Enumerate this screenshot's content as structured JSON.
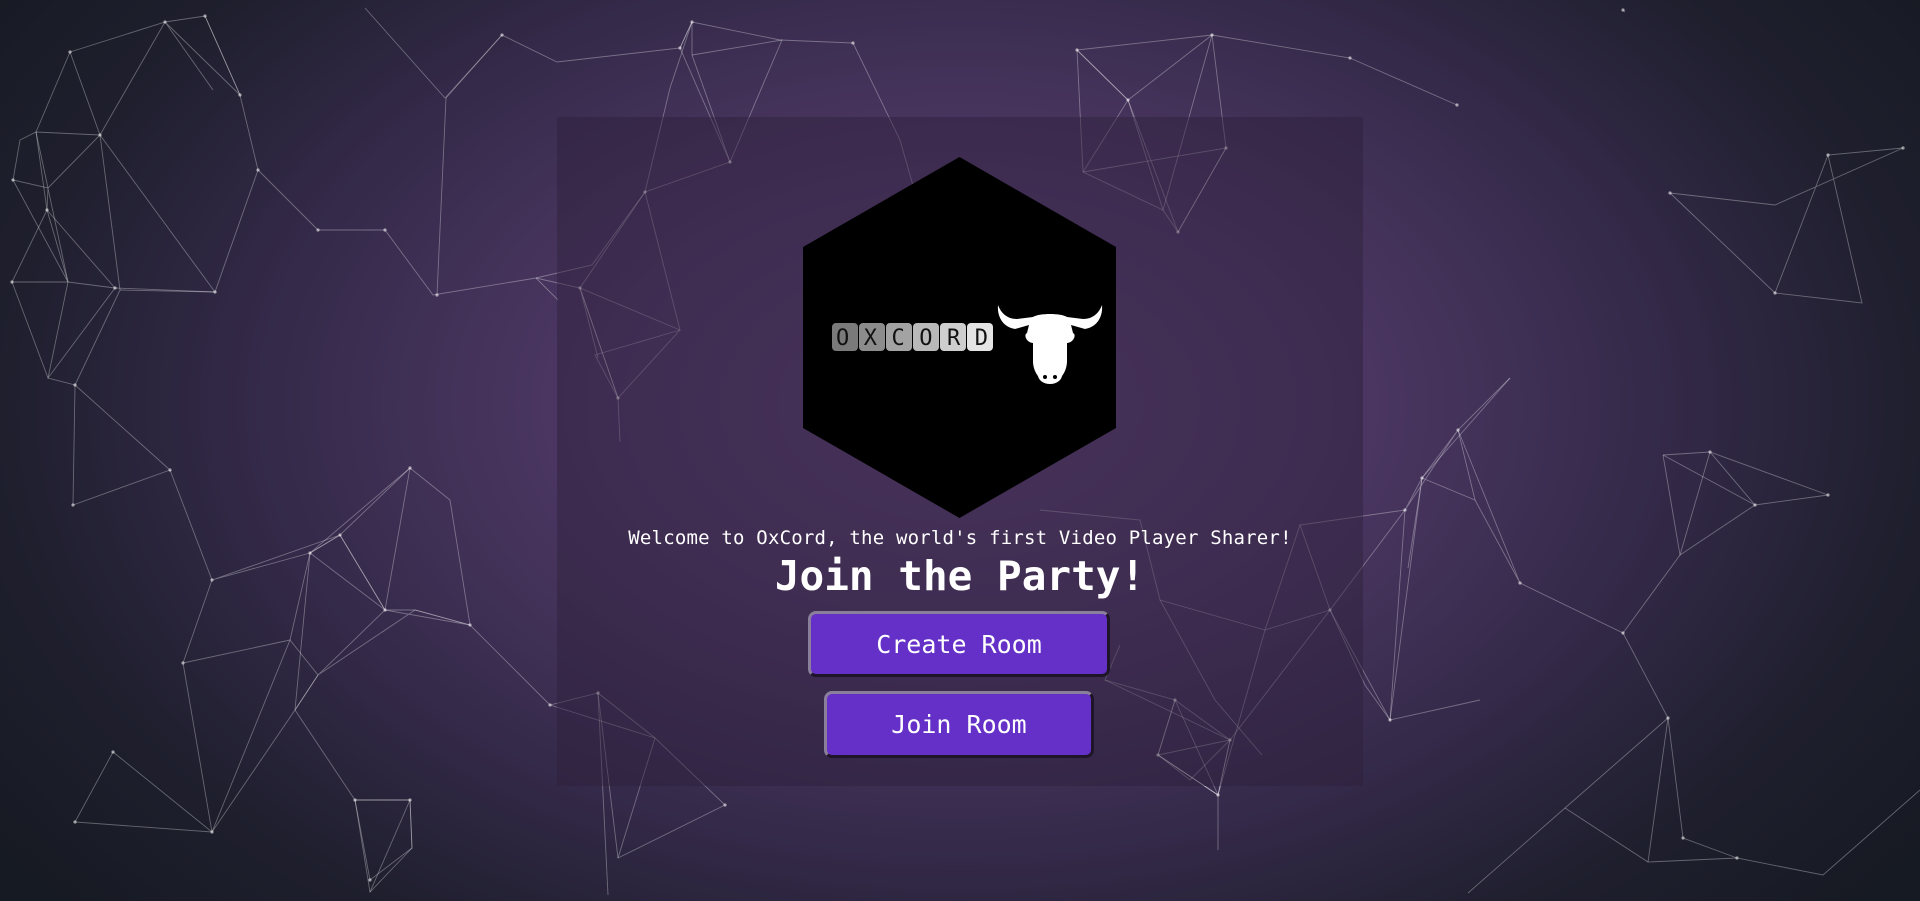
{
  "logo": {
    "wordmark": "OXCORD",
    "icon": "bull-head-icon"
  },
  "welcome_text": "Welcome to OxCord, the world's first Video Player Sharer!",
  "heading": "Join the Party!",
  "buttons": {
    "create_room": "Create Room",
    "join_room": "Join Room"
  },
  "colors": {
    "button": "#6530c8",
    "panel": "#3a2a4a",
    "background_center": "#5f4375",
    "background_edge": "#161a22"
  }
}
